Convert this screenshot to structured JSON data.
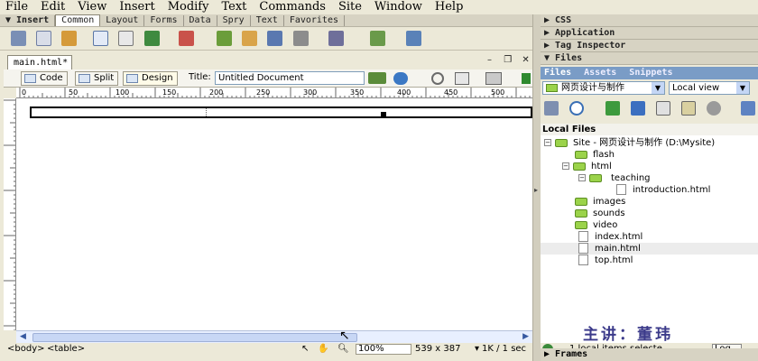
{
  "menu": [
    "File",
    "Edit",
    "View",
    "Insert",
    "Modify",
    "Text",
    "Commands",
    "Site",
    "Window",
    "Help"
  ],
  "insert_bar": {
    "title": "▼ Insert",
    "tabs": [
      "Common",
      "Layout",
      "Forms",
      "Data",
      "Spry",
      "Text",
      "Favorites"
    ]
  },
  "document": {
    "tab_label": "main.html*",
    "view_buttons": {
      "code": "Code",
      "split": "Split",
      "design": "Design"
    },
    "title_label": "Title:",
    "title_value": "Untitled Document",
    "ruler_marks": [
      "0",
      "50",
      "100",
      "150",
      "200",
      "250",
      "300",
      "350",
      "400",
      "450",
      "500",
      "550"
    ]
  },
  "status": {
    "tag1": "<body>",
    "tag2": "<table>",
    "zoom": "100%",
    "size": "539 x 387",
    "download": "1K / 1 sec"
  },
  "panels": {
    "css": "▶ CSS",
    "application": "▶ Application",
    "tag_inspector": "▶ Tag Inspector",
    "files": "▼ Files",
    "tabs": [
      "Files",
      "Assets",
      "Snippets"
    ],
    "site_select": "网页设计与制作",
    "view_select": "Local view",
    "local_files": "Local Files",
    "tree": [
      {
        "label": "Site - 网页设计与制作 (D:\\Mysite)"
      },
      {
        "label": "flash"
      },
      {
        "label": "html"
      },
      {
        "label": "teaching"
      },
      {
        "label": "introduction.html"
      },
      {
        "label": "images"
      },
      {
        "label": "sounds"
      },
      {
        "label": "video"
      },
      {
        "label": "index.html"
      },
      {
        "label": "main.html"
      },
      {
        "label": "top.html"
      }
    ],
    "status_text": "1 local items selecte",
    "log_button": "Log...",
    "frames": "▶ Frames"
  },
  "watermark": "主讲：董玮"
}
